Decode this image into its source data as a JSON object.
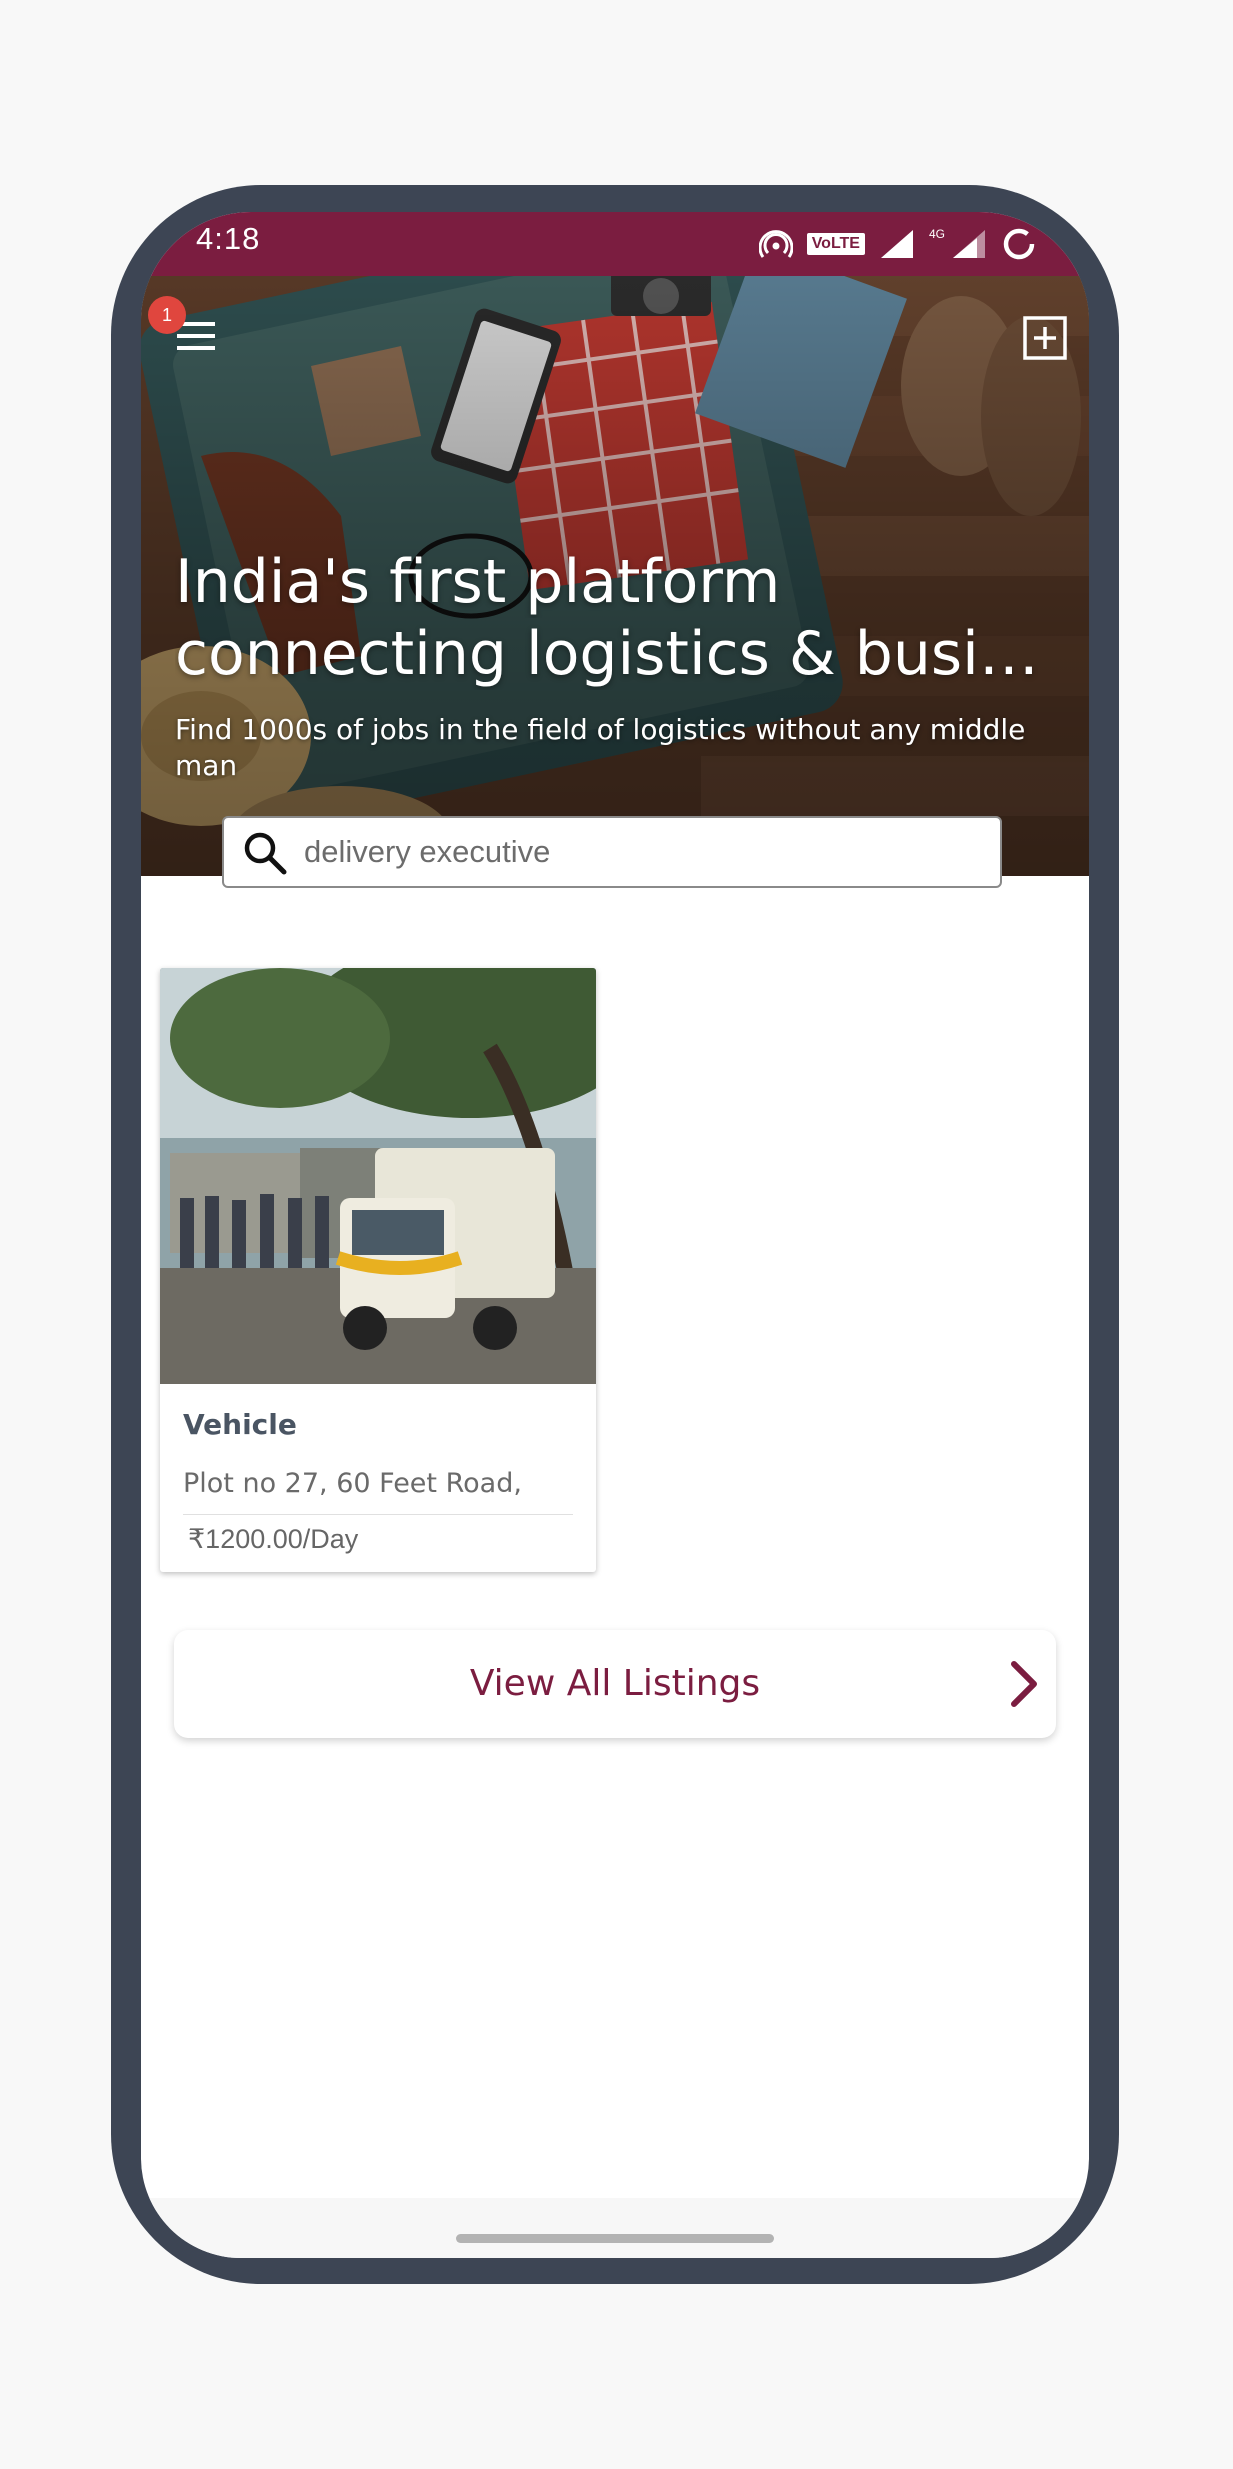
{
  "status_bar": {
    "time": "4:18",
    "volte_label": "VoLTE",
    "network_label": "4G",
    "background": "#7b1d40"
  },
  "header": {
    "menu_icon": "hamburger-menu-icon",
    "notification_count": "1",
    "add_icon": "add-post-icon"
  },
  "hero": {
    "title_line1": "India's first platform",
    "title_line2": "connecting logistics & business",
    "subtitle": "Find 1000s of jobs in the field of logistics without any middle man"
  },
  "search": {
    "placeholder": "delivery executive",
    "icon": "search-icon"
  },
  "listings": [
    {
      "title": "Vehicle",
      "address": "Plot no 27, 60 Feet Road,",
      "price": "₹1200.00/Day"
    }
  ],
  "view_all": {
    "label": "View All Listings",
    "icon": "chevron-right-icon"
  },
  "colors": {
    "brand": "#7b1d40",
    "badge": "#e0463e",
    "frame": "#3d4554"
  }
}
